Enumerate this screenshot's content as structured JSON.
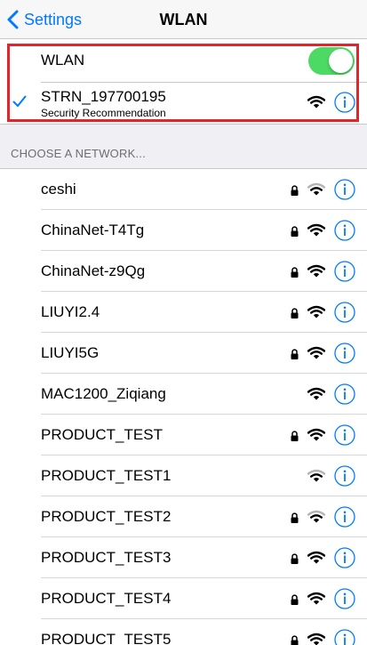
{
  "nav": {
    "back_label": "Settings",
    "title": "WLAN"
  },
  "wlan_toggle": {
    "label": "WLAN",
    "on": true
  },
  "current_network": {
    "name": "STRN_197700195",
    "subtitle": "Security Recommendation",
    "connected": true
  },
  "section_header": "CHOOSE A NETWORK...",
  "networks": [
    {
      "name": "ceshi",
      "locked": true,
      "signal": "weak"
    },
    {
      "name": "ChinaNet-T4Tg",
      "locked": true,
      "signal": "full"
    },
    {
      "name": "ChinaNet-z9Qg",
      "locked": true,
      "signal": "full"
    },
    {
      "name": "LIUYI2.4",
      "locked": true,
      "signal": "full"
    },
    {
      "name": "LIUYI5G",
      "locked": true,
      "signal": "full"
    },
    {
      "name": "MAC1200_Ziqiang",
      "locked": false,
      "signal": "full"
    },
    {
      "name": "PRODUCT_TEST",
      "locked": true,
      "signal": "full"
    },
    {
      "name": "PRODUCT_TEST1",
      "locked": false,
      "signal": "weak"
    },
    {
      "name": "PRODUCT_TEST2",
      "locked": true,
      "signal": "weak"
    },
    {
      "name": "PRODUCT_TEST3",
      "locked": true,
      "signal": "full"
    },
    {
      "name": "PRODUCT_TEST4",
      "locked": true,
      "signal": "full"
    },
    {
      "name": "PRODUCT_TEST5",
      "locked": true,
      "signal": "full"
    }
  ],
  "colors": {
    "accent": "#007aff",
    "toggle_on": "#4cd964",
    "highlight": "#e3242b",
    "background": "#efeff4"
  }
}
